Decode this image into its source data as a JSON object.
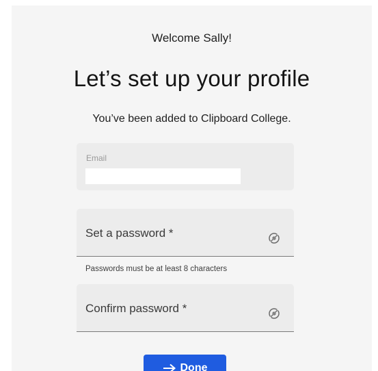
{
  "greeting": "Welcome Sally!",
  "title": "Let’s set up your profile",
  "subtitle": "You’ve been added to Clipboard College.",
  "email": {
    "label": "Email",
    "value": ""
  },
  "password": {
    "label": "Set a password *",
    "icon": "eye-icon",
    "hint": "Passwords must be at least 8 characters"
  },
  "confirm_password": {
    "label": "Confirm password *",
    "icon": "eye-icon"
  },
  "done_button": {
    "label": "Done",
    "icon": "arrow-right-icon"
  },
  "colors": {
    "page_background": "#ffffff",
    "card_background": "#f5f5f5",
    "field_background": "#ececec",
    "primary_button": "#1f5ce0"
  }
}
